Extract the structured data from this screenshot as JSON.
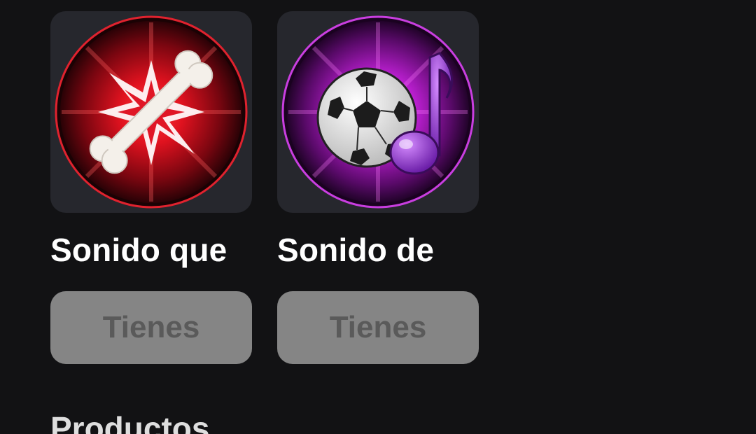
{
  "items": [
    {
      "title": "Sonido que",
      "button_label": "Tienes",
      "icon": "bone-crack-icon",
      "accent": "#d8102a"
    },
    {
      "title": "Sonido de",
      "button_label": "Tienes",
      "icon": "soccer-ball-music-icon",
      "accent": "#b81ed0"
    }
  ],
  "section": {
    "heading": "Productos"
  },
  "colors": {
    "background": "#121214",
    "card_bg": "#26272d",
    "owned_button_bg": "#858585",
    "owned_button_text": "#5a5a5a"
  }
}
